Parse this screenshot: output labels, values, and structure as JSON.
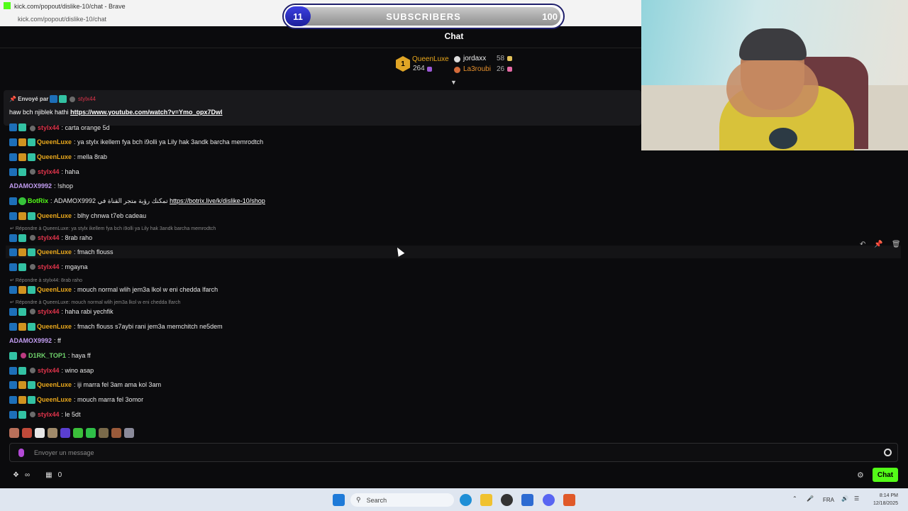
{
  "browser": {
    "tab_title": "kick.com/popout/dislike-10/chat - Brave",
    "url": "kick.com/popout/dislike-10/chat"
  },
  "subscribers": {
    "current": "11",
    "label": "SUBSCRIBERS",
    "goal": "100",
    "progress": 0.11
  },
  "chat": {
    "title": "Chat",
    "leaderboard": [
      {
        "rank": "1",
        "name": "QueenLuxe",
        "count": "264"
      },
      {
        "name": "jordaxx",
        "count": "58"
      },
      {
        "name": "La3roubi",
        "count": "26"
      }
    ],
    "pinned": {
      "sent_by": "Envoyé par",
      "user": "stylx44",
      "text": "haw bch njiblek hathi",
      "link": "https://www.youtube.com/watch?v=Ymo_opx7Dwl"
    },
    "partial_top": {
      "user": "stylx44",
      "text": "carta orange 5d"
    },
    "messages": [
      {
        "user": "QueenLuxe",
        "text": "ya stylx ikellem fya bch i9olli ya Lily hak 3andk barcha memrodtch"
      },
      {
        "user": "QueenLuxe",
        "text": "mella 8rab"
      },
      {
        "user": "stylx44",
        "text": "haha"
      },
      {
        "user": "ADAMOX9992",
        "text": "!shop"
      },
      {
        "user": "BotRix",
        "text": "ADAMOX9992 تمكنك رؤية متجر القناة في",
        "link": "https://botrix.live/k/dislike-10/shop"
      },
      {
        "user": "QueenLuxe",
        "text": "blhy chnwa t7eb cadeau"
      },
      {
        "reply": "Répondre à QueenLuxe: ya stylx ikellem fya bch i9olli ya Lily hak 3andk barcha memrodtch"
      },
      {
        "user": "stylx44",
        "text": "8rab raho"
      },
      {
        "user": "QueenLuxe",
        "text": "fmach flouss"
      },
      {
        "user": "stylx44",
        "text": "mgayna"
      },
      {
        "reply": "Répondre à stylx44: 8rab raho"
      },
      {
        "user": "QueenLuxe",
        "text": "mouch normal wlih jem3a lkol w eni chedda lfarch"
      },
      {
        "reply": "Répondre à QueenLuxe: mouch normal wlih jem3a lkol w eni chedda lfarch"
      },
      {
        "user": "stylx44",
        "text": "haha rabi yechfik"
      },
      {
        "user": "QueenLuxe",
        "text": "fmach flouss s7aybi rani jem3a memchitch ne5dem"
      },
      {
        "user": "ADAMOX9992",
        "text": "ff"
      },
      {
        "user": "D1RK_TOP1",
        "text": "haya ff"
      },
      {
        "user": "stylx44",
        "text": "wino asap"
      },
      {
        "user": "QueenLuxe",
        "text": "iji marra fel 3am ama kol 3am"
      },
      {
        "user": "QueenLuxe",
        "text": "mouch marra fel 3omor"
      },
      {
        "user": "stylx44",
        "text": "le 5dt"
      }
    ],
    "input_placeholder": "Envoyer un message",
    "gift_count": "0",
    "send_label": "Chat"
  },
  "taskbar": {
    "search_label": "Search",
    "lang": "FRA",
    "time": "8:14 PM",
    "date": "12/18/2025"
  },
  "colors": {
    "kick_green": "#53fc18",
    "queen_color": "#e8a71c",
    "stylx_color": "#e0344b",
    "adamox_color": "#c19cf0",
    "botrix_color": "#53fc18",
    "dirk_color": "#6fd36c"
  }
}
